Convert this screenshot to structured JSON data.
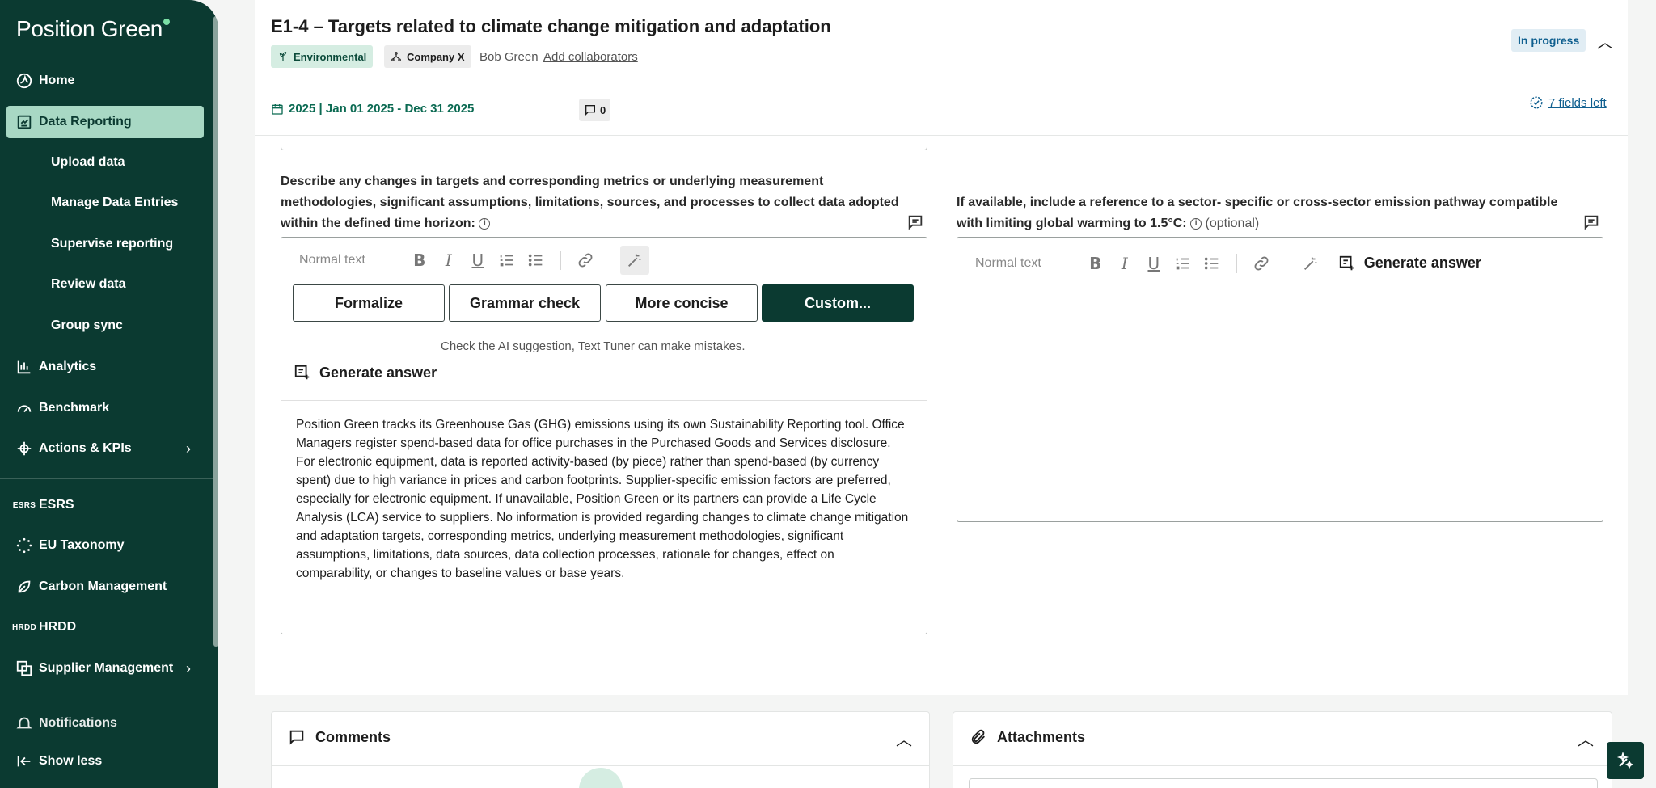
{
  "sidebar": {
    "logo": "Position Green",
    "items": [
      {
        "label": "Home"
      },
      {
        "label": "Data Reporting"
      },
      {
        "label": "Upload data"
      },
      {
        "label": "Manage Data Entries"
      },
      {
        "label": "Supervise reporting"
      },
      {
        "label": "Review data"
      },
      {
        "label": "Group sync"
      },
      {
        "label": "Analytics"
      },
      {
        "label": "Benchmark"
      },
      {
        "label": "Actions & KPIs"
      },
      {
        "label": "ESRS",
        "icon_text": "ESRS"
      },
      {
        "label": "EU Taxonomy"
      },
      {
        "label": "Carbon Management"
      },
      {
        "label": "HRDD",
        "icon_text": "HRDD"
      },
      {
        "label": "Supplier Management"
      },
      {
        "label": "Notifications"
      }
    ],
    "show_less": "Show less"
  },
  "header": {
    "title": "E1-4 – Targets related to climate change mitigation and adaptation",
    "tag_environmental": "Environmental",
    "tag_company": "Company X",
    "owner": "Bob Green",
    "add_collaborators": "Add collaborators",
    "status": "In progress",
    "period": "2025 | Jan 01 2025 - Dec 31 2025",
    "comment_count": "0",
    "fields_left": "7 fields left"
  },
  "left_question": {
    "label": "Describe any changes in targets and corresponding metrics or underlying measurement methodologies, significant assumptions, limitations, sources, and processes to collect data adopted within the defined time horizon:",
    "toolbar_placeholder": "Normal text",
    "buttons": [
      "Formalize",
      "Grammar check",
      "More concise",
      "Custom..."
    ],
    "ai_note": "Check the AI suggestion, Text Tuner can make mistakes.",
    "generate": "Generate answer",
    "answer": "Position Green tracks its Greenhouse Gas (GHG) emissions using its own Sustainability Reporting tool. Office Managers register spend-based data for office purchases in the Purchased Goods and Services disclosure. For electronic equipment, data is reported activity-based (by piece) rather than spend-based (by currency spent) due to high variance in prices and carbon footprints. Supplier-specific emission factors are preferred, especially for electronic equipment. If unavailable, Position Green or its partners can provide a Life Cycle Analysis (LCA) service to suppliers. No information is provided regarding changes to climate change mitigation and adaptation targets, corresponding metrics, underlying measurement methodologies, significant assumptions, limitations, data sources, data collection processes, rationale for changes, effect on comparability, or changes to baseline values or base years."
  },
  "right_question": {
    "label": "If available, include a reference to a sector- specific or cross-sector emission pathway compatible with limiting global warming to 1.5°C:",
    "optional": "(optional)",
    "toolbar_placeholder": "Normal text",
    "generate": "Generate answer"
  },
  "panels": {
    "comments": "Comments",
    "attachments": "Attachments"
  }
}
